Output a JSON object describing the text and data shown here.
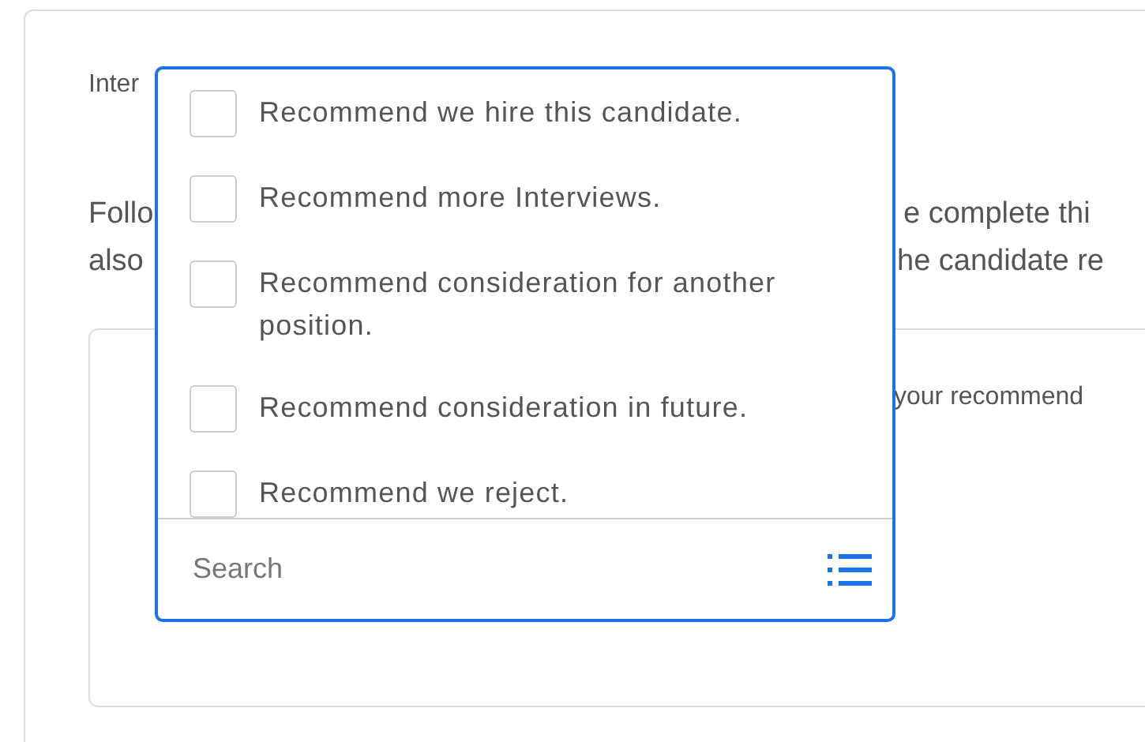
{
  "card": {
    "label_fragment": "Inter",
    "paragraph_fragments": [
      {
        "left": "Follo",
        "right": "e complete thi"
      },
      {
        "left": "also",
        "right": "he candidate re"
      }
    ],
    "textarea_fragment": "your recommend"
  },
  "dropdown": {
    "options": [
      {
        "label": "Recommend we hire this candidate.",
        "checked": false
      },
      {
        "label": "Recommend more Interviews.",
        "checked": false
      },
      {
        "label": "Recommend consideration for another position.",
        "checked": false
      },
      {
        "label": "Recommend consideration in future.",
        "checked": false
      },
      {
        "label": "Recommend we reject.",
        "checked": false
      }
    ],
    "search": {
      "placeholder": "Search"
    }
  }
}
